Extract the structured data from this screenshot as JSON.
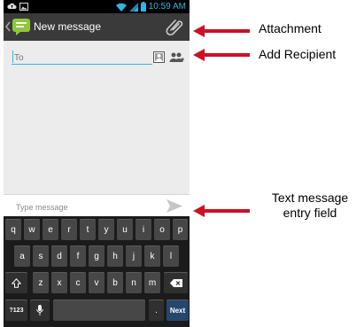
{
  "status_bar": {
    "time": "10:59 AM"
  },
  "action_bar": {
    "title": "New message"
  },
  "recipient": {
    "placeholder": "To"
  },
  "compose": {
    "placeholder": "Type message"
  },
  "keyboard": {
    "row1": [
      "q",
      "w",
      "e",
      "r",
      "t",
      "y",
      "u",
      "i",
      "o",
      "p"
    ],
    "row2": [
      "a",
      "s",
      "d",
      "f",
      "g",
      "h",
      "j",
      "k",
      "l"
    ],
    "row3": [
      "z",
      "x",
      "c",
      "v",
      "b",
      "n",
      "m"
    ],
    "symbols_label": "?123",
    "period_label": ".",
    "next_label": "Next"
  },
  "annotations": {
    "attachment": "Attachment",
    "add_recipient": "Add Recipient",
    "text_entry_line1": "Text message",
    "text_entry_line2": "entry field"
  },
  "colors": {
    "accent": "#33b5e5",
    "arrow": "#cc1122",
    "action_bar": "#3a3a3a",
    "keyboard_bg": "#1b1b1b",
    "key": "#474747",
    "next_key": "#24476d"
  },
  "icons": {
    "status_left": [
      "cloud-upload-icon",
      "image-icon"
    ],
    "status_right": [
      "wifi-icon",
      "signal-icon",
      "battery-icon"
    ],
    "attachment": "paperclip-icon",
    "contact": "contact-card-icon",
    "add_group": "add-people-icon",
    "send": "send-icon",
    "shift": "shift-icon",
    "backspace": "backspace-icon",
    "mic": "mic-icon"
  }
}
